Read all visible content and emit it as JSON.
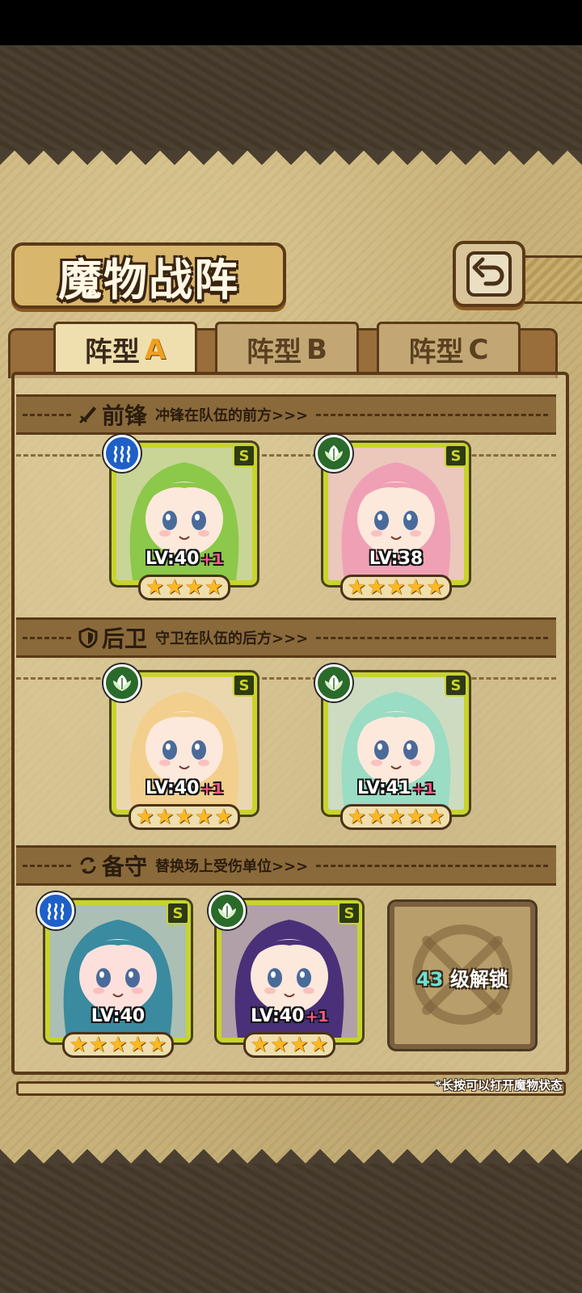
{
  "title": "魔物战阵",
  "tabs": [
    {
      "name": "阵型",
      "letter": "A",
      "active": true
    },
    {
      "name": "阵型",
      "letter": "B",
      "active": false
    },
    {
      "name": "阵型",
      "letter": "C",
      "active": false
    }
  ],
  "sections": {
    "front": {
      "title": "前锋",
      "desc": "冲锋在队伍的前方>>>",
      "icon": "sword-icon"
    },
    "rear": {
      "title": "后卫",
      "desc": "守卫在队伍的后方>>>",
      "icon": "shield-icon"
    },
    "reserve": {
      "title": "备守",
      "desc": "替换场上受伤单位>>>",
      "icon": "swap-icon"
    }
  },
  "monsters": [
    {
      "slot": "front-1",
      "element": "water",
      "rank": "S",
      "level": "LV:40",
      "bonus": "+1",
      "stars": 4,
      "hair": "#8cc84a",
      "skin": "#fde8dc"
    },
    {
      "slot": "front-2",
      "element": "grass",
      "rank": "S",
      "level": "LV:38",
      "bonus": "",
      "stars": 5,
      "hair": "#f0a0b4",
      "skin": "#fde8dc"
    },
    {
      "slot": "rear-1",
      "element": "grass",
      "rank": "S",
      "level": "LV:40",
      "bonus": "+1",
      "stars": 5,
      "hair": "#f2cf8c",
      "skin": "#fde8dc"
    },
    {
      "slot": "rear-2",
      "element": "grass",
      "rank": "S",
      "level": "LV:41",
      "bonus": "+1",
      "stars": 5,
      "hair": "#9adcc4",
      "skin": "#fde8dc"
    },
    {
      "slot": "reserve-1",
      "element": "water",
      "rank": "S",
      "level": "LV:40",
      "bonus": "",
      "stars": 5,
      "hair": "#3a8aa0",
      "skin": "#fde0dc"
    },
    {
      "slot": "reserve-2",
      "element": "grass",
      "rank": "S",
      "level": "LV:40",
      "bonus": "+1",
      "stars": 4,
      "hair": "#4a3078",
      "skin": "#fde8dc"
    }
  ],
  "locked": {
    "level": "43",
    "text": "级解锁"
  },
  "hint": "*长按可以打开魔物状态",
  "colors": {
    "frame": "#c8d42c",
    "water": "#1e60c8",
    "grass": "#2a6a2a",
    "star": "#ffb820",
    "plus": "#ff5a8a",
    "unlockNum": "#6ee0d0"
  }
}
